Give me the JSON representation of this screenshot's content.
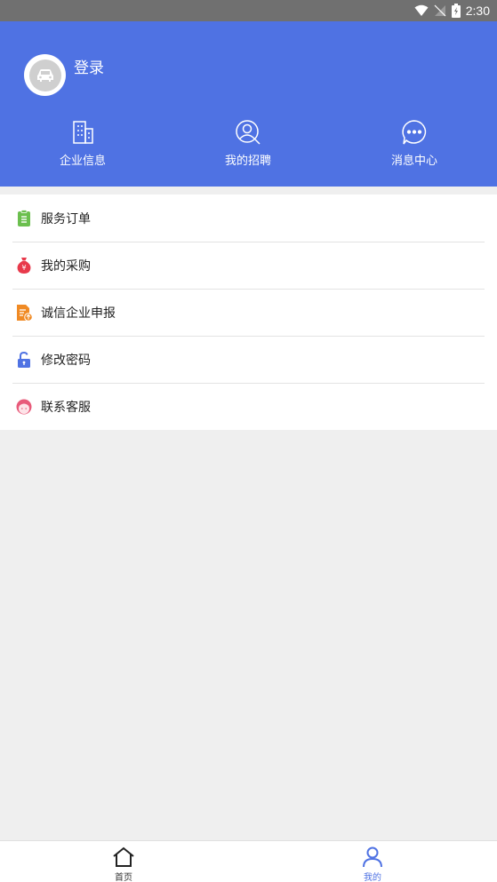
{
  "status_bar": {
    "time": "2:30"
  },
  "header": {
    "login_label": "登录",
    "quick_links": [
      {
        "label": "企业信息",
        "icon": "building-icon"
      },
      {
        "label": "我的招聘",
        "icon": "user-search-icon"
      },
      {
        "label": "消息中心",
        "icon": "chat-bubble-icon"
      }
    ],
    "background_color": "#4f72e3"
  },
  "menu": {
    "items": [
      {
        "label": "服务订单",
        "icon": "clipboard-icon",
        "color": "#6bbf4e"
      },
      {
        "label": "我的采购",
        "icon": "money-bag-icon",
        "color": "#e8394b"
      },
      {
        "label": "诚信企业申报",
        "icon": "document-upload-icon",
        "color": "#f08a24"
      },
      {
        "label": "修改密码",
        "icon": "unlock-icon",
        "color": "#4f72e3"
      },
      {
        "label": "联系客服",
        "icon": "customer-service-icon",
        "color": "#e85a7a"
      }
    ]
  },
  "tabbar": {
    "tabs": [
      {
        "label": "首页",
        "icon": "home-icon",
        "active": false
      },
      {
        "label": "我的",
        "icon": "profile-icon",
        "active": true
      }
    ]
  }
}
